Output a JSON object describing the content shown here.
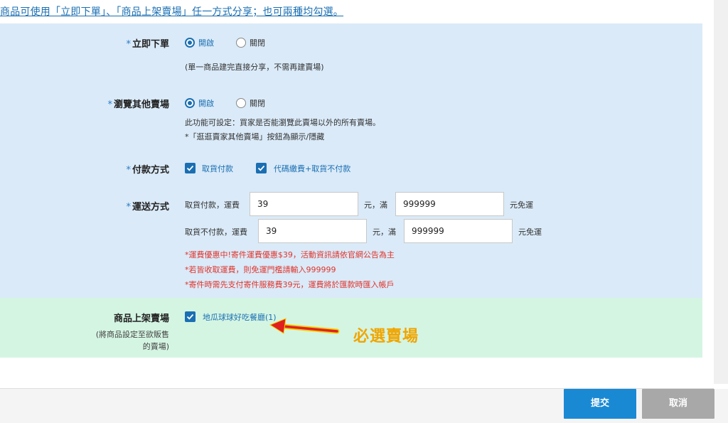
{
  "top_note": "商品可使用「立即下單」、「商品上架賣場」任一方式分享；也可兩種均勾選。",
  "required_mark": "*",
  "instant_order": {
    "label": "立即下單",
    "option_on": "開啟",
    "option_off": "關閉",
    "selected": "開啟",
    "hint": "(單一商品建完直接分享，不需再建賣場)"
  },
  "browse_other": {
    "label": "瀏覽其他賣場",
    "option_on": "開啟",
    "option_off": "關閉",
    "selected": "開啟",
    "hint_line1": "此功能可設定：買家是否能瀏覽此賣場以外的所有賣場。",
    "hint_line2": "*「逛逛賣家其他賣場」按鈕為顯示/隱藏"
  },
  "payment": {
    "label": "付款方式",
    "options": [
      {
        "label": "取貨付款",
        "checked": true
      },
      {
        "label": "代碼繳費+取貨不付款",
        "checked": true
      }
    ]
  },
  "shipping": {
    "label": "運送方式",
    "rows": [
      {
        "prefix": "取貨付款，運費",
        "fee": "39",
        "mid": "元，滿",
        "threshold": "999999",
        "suffix": "元免運"
      },
      {
        "prefix": "取貨不付款，運費",
        "fee": "39",
        "mid": "元，滿",
        "threshold": "999999",
        "suffix": "元免運"
      }
    ],
    "notes": [
      "*運費優惠中!寄件運費優惠$39，活動資訊請依官網公告為主",
      "*若皆收取運費，則免運門檻請輸入999999",
      "*寄件時需先支付寄件服務費39元，運費將於匯款時匯入帳戶"
    ]
  },
  "store_listing": {
    "label": "商品上架賣場",
    "sub_line1": "(將商品設定至欲販售",
    "sub_line2": "的賣場)",
    "store": {
      "label": "地瓜球球好吃餐廳(1)",
      "checked": true
    }
  },
  "annotation": "必選賣場",
  "buttons": {
    "submit": "提交",
    "cancel": "取消"
  },
  "colors": {
    "accent": "#1a6fb3",
    "panel_blue": "#daeaf8",
    "panel_green": "#d5f5e3",
    "note_red": "#e0342b",
    "annotation": "#f0a500",
    "arrow": "#e02020"
  }
}
